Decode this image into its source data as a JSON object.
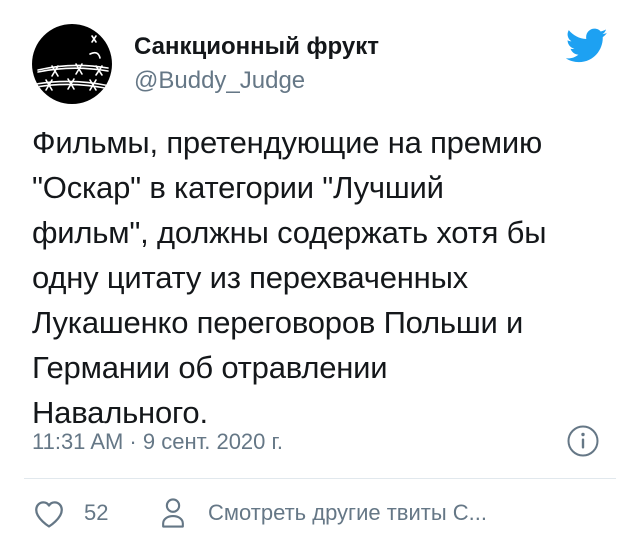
{
  "tweet": {
    "author": {
      "display_name": "Санкционный фрукт",
      "handle": "@Buddy_Judge",
      "avatar_icon": "barbed-wire-avatar"
    },
    "brand_icon": "twitter-bird-icon",
    "brand_color": "#1da1f2",
    "text_lines": [
      "Фильмы, претендующие на премию",
      "\"Оскар\" в категории \"Лучший",
      "фильм\", должны содержать хотя бы",
      "одну цитату из перехваченных",
      "Лукашенко переговоров Польши и",
      "Германии об отравлении",
      "Навального."
    ],
    "timestamp": "11:31 AM · 9 сент. 2020 г.",
    "info_icon": "info-icon",
    "actions": {
      "like_icon": "heart-icon",
      "like_count": "52",
      "profile_icon": "person-icon",
      "profile_label": "Смотреть другие твиты С..."
    },
    "colors": {
      "text": "#14171a",
      "secondary": "#657786",
      "divider": "#e1e8ed"
    }
  }
}
